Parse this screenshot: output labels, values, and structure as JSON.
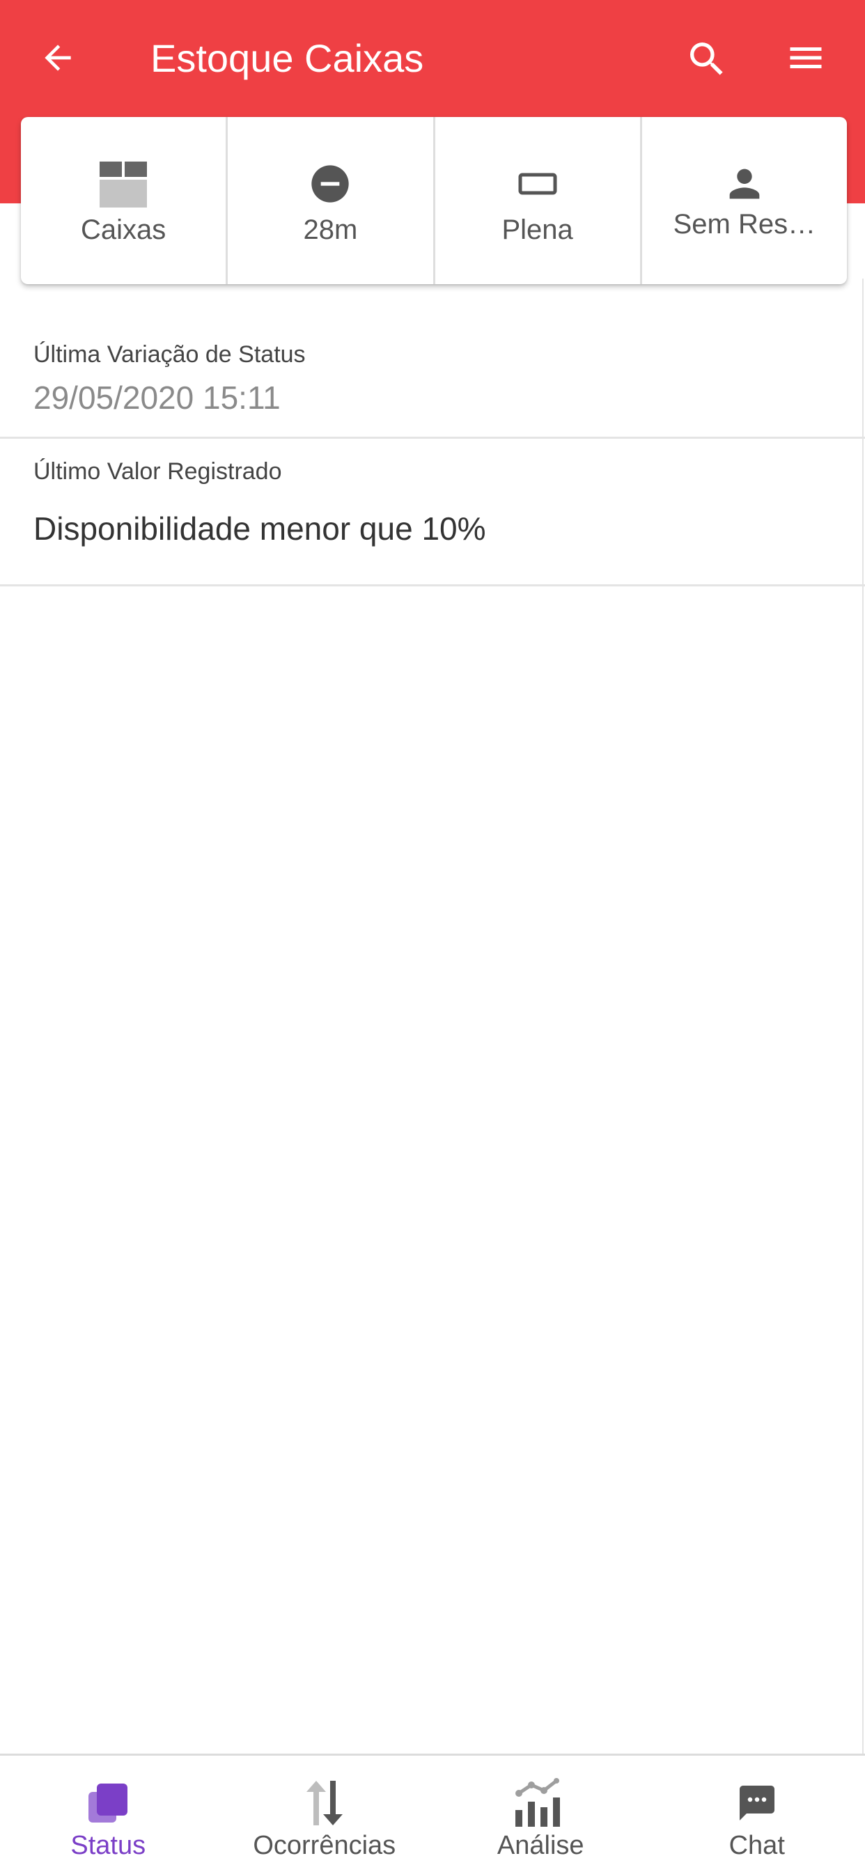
{
  "app_bar": {
    "title": "Estoque Caixas",
    "back_icon": "arrow-back-icon",
    "search_icon": "search-icon",
    "menu_icon": "hamburger-menu-icon",
    "background_color": "#ef4044"
  },
  "summary": {
    "items": [
      {
        "label": "Caixas",
        "icon": "box-icon"
      },
      {
        "label": "28m",
        "icon": "minus-circle-icon"
      },
      {
        "label": "Plena",
        "icon": "rectangle-outline-icon"
      },
      {
        "label": "Sem Res…",
        "icon": "person-icon"
      }
    ]
  },
  "details": {
    "last_status_change": {
      "caption": "Última Variação de Status",
      "value": "29/05/2020 15:11"
    },
    "last_value": {
      "caption": "Último Valor Registrado",
      "value": "Disponibilidade menor que 10%"
    }
  },
  "bottom_nav": {
    "active_color": "#7b3fc7",
    "items": [
      {
        "label": "Status",
        "icon": "status-layers-icon",
        "active": true
      },
      {
        "label": "Ocorrências",
        "icon": "swap-vertical-icon",
        "active": false
      },
      {
        "label": "Análise",
        "icon": "bar-chart-icon",
        "active": false
      },
      {
        "label": "Chat",
        "icon": "chat-bubble-icon",
        "active": false
      }
    ]
  }
}
